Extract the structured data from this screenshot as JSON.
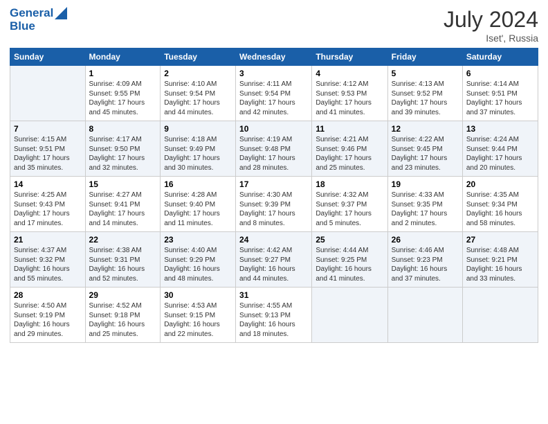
{
  "header": {
    "logo_line1": "General",
    "logo_line2": "Blue",
    "title": "July 2024",
    "location": "Iset', Russia"
  },
  "weekdays": [
    "Sunday",
    "Monday",
    "Tuesday",
    "Wednesday",
    "Thursday",
    "Friday",
    "Saturday"
  ],
  "weeks": [
    [
      {
        "day": "",
        "info": ""
      },
      {
        "day": "1",
        "info": "Sunrise: 4:09 AM\nSunset: 9:55 PM\nDaylight: 17 hours\nand 45 minutes."
      },
      {
        "day": "2",
        "info": "Sunrise: 4:10 AM\nSunset: 9:54 PM\nDaylight: 17 hours\nand 44 minutes."
      },
      {
        "day": "3",
        "info": "Sunrise: 4:11 AM\nSunset: 9:54 PM\nDaylight: 17 hours\nand 42 minutes."
      },
      {
        "day": "4",
        "info": "Sunrise: 4:12 AM\nSunset: 9:53 PM\nDaylight: 17 hours\nand 41 minutes."
      },
      {
        "day": "5",
        "info": "Sunrise: 4:13 AM\nSunset: 9:52 PM\nDaylight: 17 hours\nand 39 minutes."
      },
      {
        "day": "6",
        "info": "Sunrise: 4:14 AM\nSunset: 9:51 PM\nDaylight: 17 hours\nand 37 minutes."
      }
    ],
    [
      {
        "day": "7",
        "info": "Sunrise: 4:15 AM\nSunset: 9:51 PM\nDaylight: 17 hours\nand 35 minutes."
      },
      {
        "day": "8",
        "info": "Sunrise: 4:17 AM\nSunset: 9:50 PM\nDaylight: 17 hours\nand 32 minutes."
      },
      {
        "day": "9",
        "info": "Sunrise: 4:18 AM\nSunset: 9:49 PM\nDaylight: 17 hours\nand 30 minutes."
      },
      {
        "day": "10",
        "info": "Sunrise: 4:19 AM\nSunset: 9:48 PM\nDaylight: 17 hours\nand 28 minutes."
      },
      {
        "day": "11",
        "info": "Sunrise: 4:21 AM\nSunset: 9:46 PM\nDaylight: 17 hours\nand 25 minutes."
      },
      {
        "day": "12",
        "info": "Sunrise: 4:22 AM\nSunset: 9:45 PM\nDaylight: 17 hours\nand 23 minutes."
      },
      {
        "day": "13",
        "info": "Sunrise: 4:24 AM\nSunset: 9:44 PM\nDaylight: 17 hours\nand 20 minutes."
      }
    ],
    [
      {
        "day": "14",
        "info": "Sunrise: 4:25 AM\nSunset: 9:43 PM\nDaylight: 17 hours\nand 17 minutes."
      },
      {
        "day": "15",
        "info": "Sunrise: 4:27 AM\nSunset: 9:41 PM\nDaylight: 17 hours\nand 14 minutes."
      },
      {
        "day": "16",
        "info": "Sunrise: 4:28 AM\nSunset: 9:40 PM\nDaylight: 17 hours\nand 11 minutes."
      },
      {
        "day": "17",
        "info": "Sunrise: 4:30 AM\nSunset: 9:39 PM\nDaylight: 17 hours\nand 8 minutes."
      },
      {
        "day": "18",
        "info": "Sunrise: 4:32 AM\nSunset: 9:37 PM\nDaylight: 17 hours\nand 5 minutes."
      },
      {
        "day": "19",
        "info": "Sunrise: 4:33 AM\nSunset: 9:35 PM\nDaylight: 17 hours\nand 2 minutes."
      },
      {
        "day": "20",
        "info": "Sunrise: 4:35 AM\nSunset: 9:34 PM\nDaylight: 16 hours\nand 58 minutes."
      }
    ],
    [
      {
        "day": "21",
        "info": "Sunrise: 4:37 AM\nSunset: 9:32 PM\nDaylight: 16 hours\nand 55 minutes."
      },
      {
        "day": "22",
        "info": "Sunrise: 4:38 AM\nSunset: 9:31 PM\nDaylight: 16 hours\nand 52 minutes."
      },
      {
        "day": "23",
        "info": "Sunrise: 4:40 AM\nSunset: 9:29 PM\nDaylight: 16 hours\nand 48 minutes."
      },
      {
        "day": "24",
        "info": "Sunrise: 4:42 AM\nSunset: 9:27 PM\nDaylight: 16 hours\nand 44 minutes."
      },
      {
        "day": "25",
        "info": "Sunrise: 4:44 AM\nSunset: 9:25 PM\nDaylight: 16 hours\nand 41 minutes."
      },
      {
        "day": "26",
        "info": "Sunrise: 4:46 AM\nSunset: 9:23 PM\nDaylight: 16 hours\nand 37 minutes."
      },
      {
        "day": "27",
        "info": "Sunrise: 4:48 AM\nSunset: 9:21 PM\nDaylight: 16 hours\nand 33 minutes."
      }
    ],
    [
      {
        "day": "28",
        "info": "Sunrise: 4:50 AM\nSunset: 9:19 PM\nDaylight: 16 hours\nand 29 minutes."
      },
      {
        "day": "29",
        "info": "Sunrise: 4:52 AM\nSunset: 9:18 PM\nDaylight: 16 hours\nand 25 minutes."
      },
      {
        "day": "30",
        "info": "Sunrise: 4:53 AM\nSunset: 9:15 PM\nDaylight: 16 hours\nand 22 minutes."
      },
      {
        "day": "31",
        "info": "Sunrise: 4:55 AM\nSunset: 9:13 PM\nDaylight: 16 hours\nand 18 minutes."
      },
      {
        "day": "",
        "info": ""
      },
      {
        "day": "",
        "info": ""
      },
      {
        "day": "",
        "info": ""
      }
    ]
  ]
}
